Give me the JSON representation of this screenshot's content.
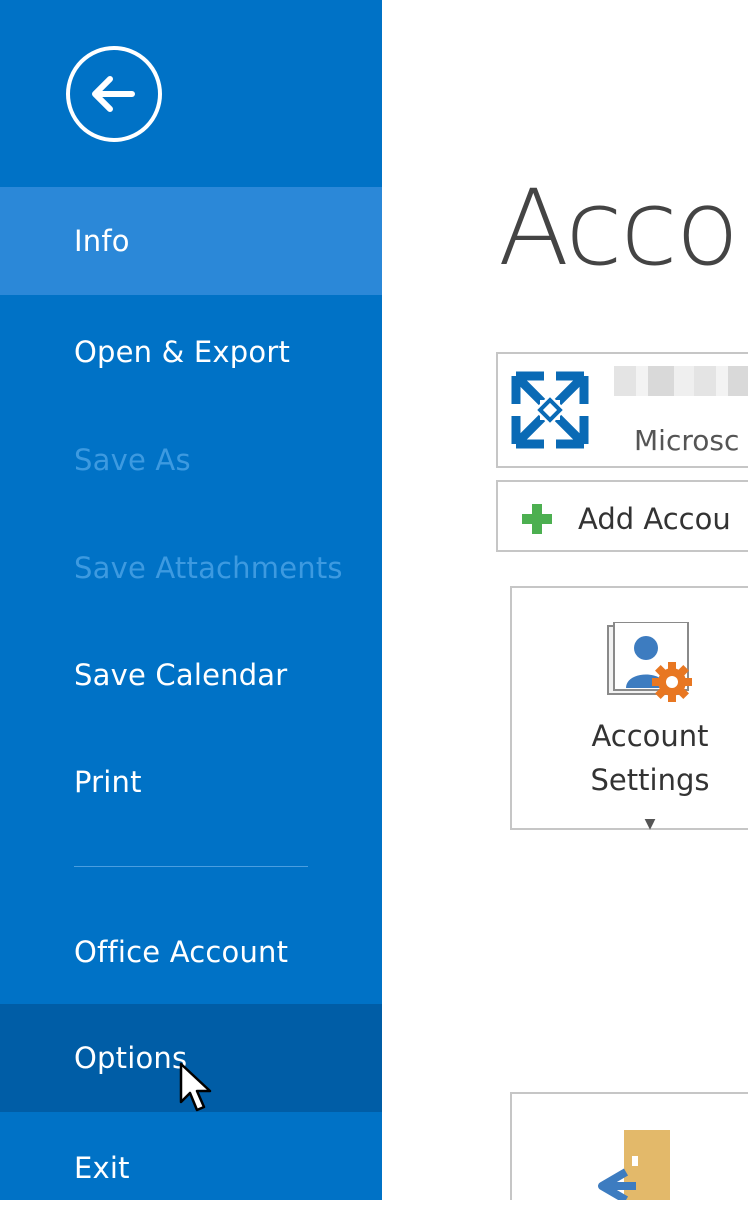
{
  "sidebar": {
    "back_label": "Back",
    "items": [
      {
        "label": "Info",
        "state": "active"
      },
      {
        "label": "Open & Export",
        "state": "normal"
      },
      {
        "label": "Save As",
        "state": "disabled"
      },
      {
        "label": "Save Attachments",
        "state": "disabled"
      },
      {
        "label": "Save Calendar",
        "state": "normal"
      },
      {
        "label": "Print",
        "state": "normal"
      },
      {
        "label": "Office Account",
        "state": "normal"
      },
      {
        "label": "Options",
        "state": "hover"
      },
      {
        "label": "Exit",
        "state": "normal"
      }
    ]
  },
  "main": {
    "title": "Accou",
    "account": {
      "type": "Microsc",
      "icon": "exchange-icon"
    },
    "add_account": {
      "label": "Add Accou",
      "icon": "plus-icon"
    },
    "account_settings": {
      "line1": "Account",
      "line2": "Settings",
      "icon": "account-settings-icon"
    }
  },
  "colors": {
    "sidebar_bg": "#0072c6",
    "active_bg": "#2b88d8",
    "hover_bg": "#005da6",
    "disabled_text": "#3d9ae0",
    "tile_border": "#c6c6c6",
    "exchange_blue": "#0a6ab5",
    "plus_green": "#4caf50",
    "gear_orange": "#e87722"
  }
}
